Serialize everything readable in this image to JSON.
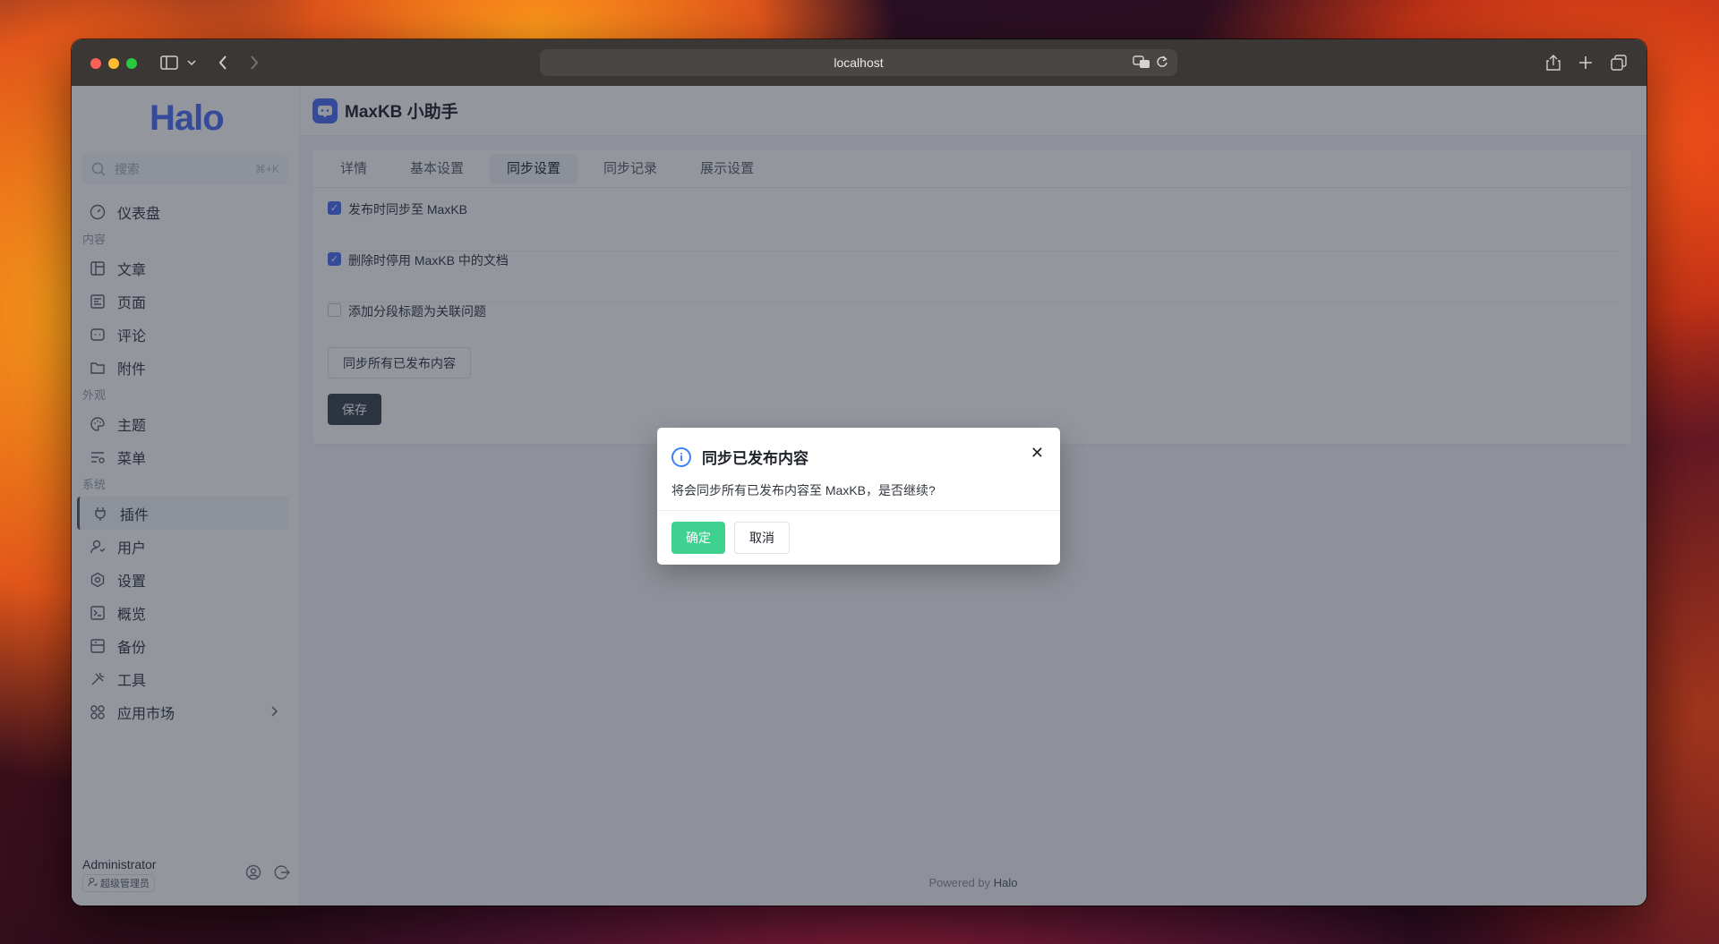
{
  "browser": {
    "url": "localhost"
  },
  "sidebar": {
    "logo": "Halo",
    "search": {
      "placeholder": "搜索",
      "shortcut": "⌘+K"
    },
    "dashboard": "仪表盘",
    "groups": {
      "content": "内容",
      "appearance": "外观",
      "system": "系统"
    },
    "items": {
      "posts": "文章",
      "pages": "页面",
      "comments": "评论",
      "attachments": "附件",
      "themes": "主题",
      "menus": "菜单",
      "plugins": "插件",
      "users": "用户",
      "settings": "设置",
      "overview": "概览",
      "backup": "备份",
      "tools": "工具",
      "app_market": "应用市场"
    },
    "user": {
      "name": "Administrator",
      "role": "超级管理员"
    }
  },
  "page": {
    "title": "MaxKB 小助手",
    "tabs": [
      "详情",
      "基本设置",
      "同步设置",
      "同步记录",
      "展示设置"
    ],
    "active_tab": "同步设置",
    "options": [
      {
        "label": "发布时同步至 MaxKB",
        "checked": true
      },
      {
        "label": "删除时停用 MaxKB 中的文档",
        "checked": true
      },
      {
        "label": "添加分段标题为关联问题",
        "checked": false
      }
    ],
    "sync_all_button": "同步所有已发布内容",
    "save_button": "保存",
    "footer_prefix": "Powered by ",
    "footer_brand": "Halo"
  },
  "modal": {
    "title": "同步已发布内容",
    "message": "将会同步所有已发布内容至 MaxKB，是否继续?",
    "confirm": "确定",
    "cancel": "取消"
  },
  "colors": {
    "primary": "#4b6ef5",
    "confirm": "#3fd18f",
    "info": "#3b82f6"
  }
}
